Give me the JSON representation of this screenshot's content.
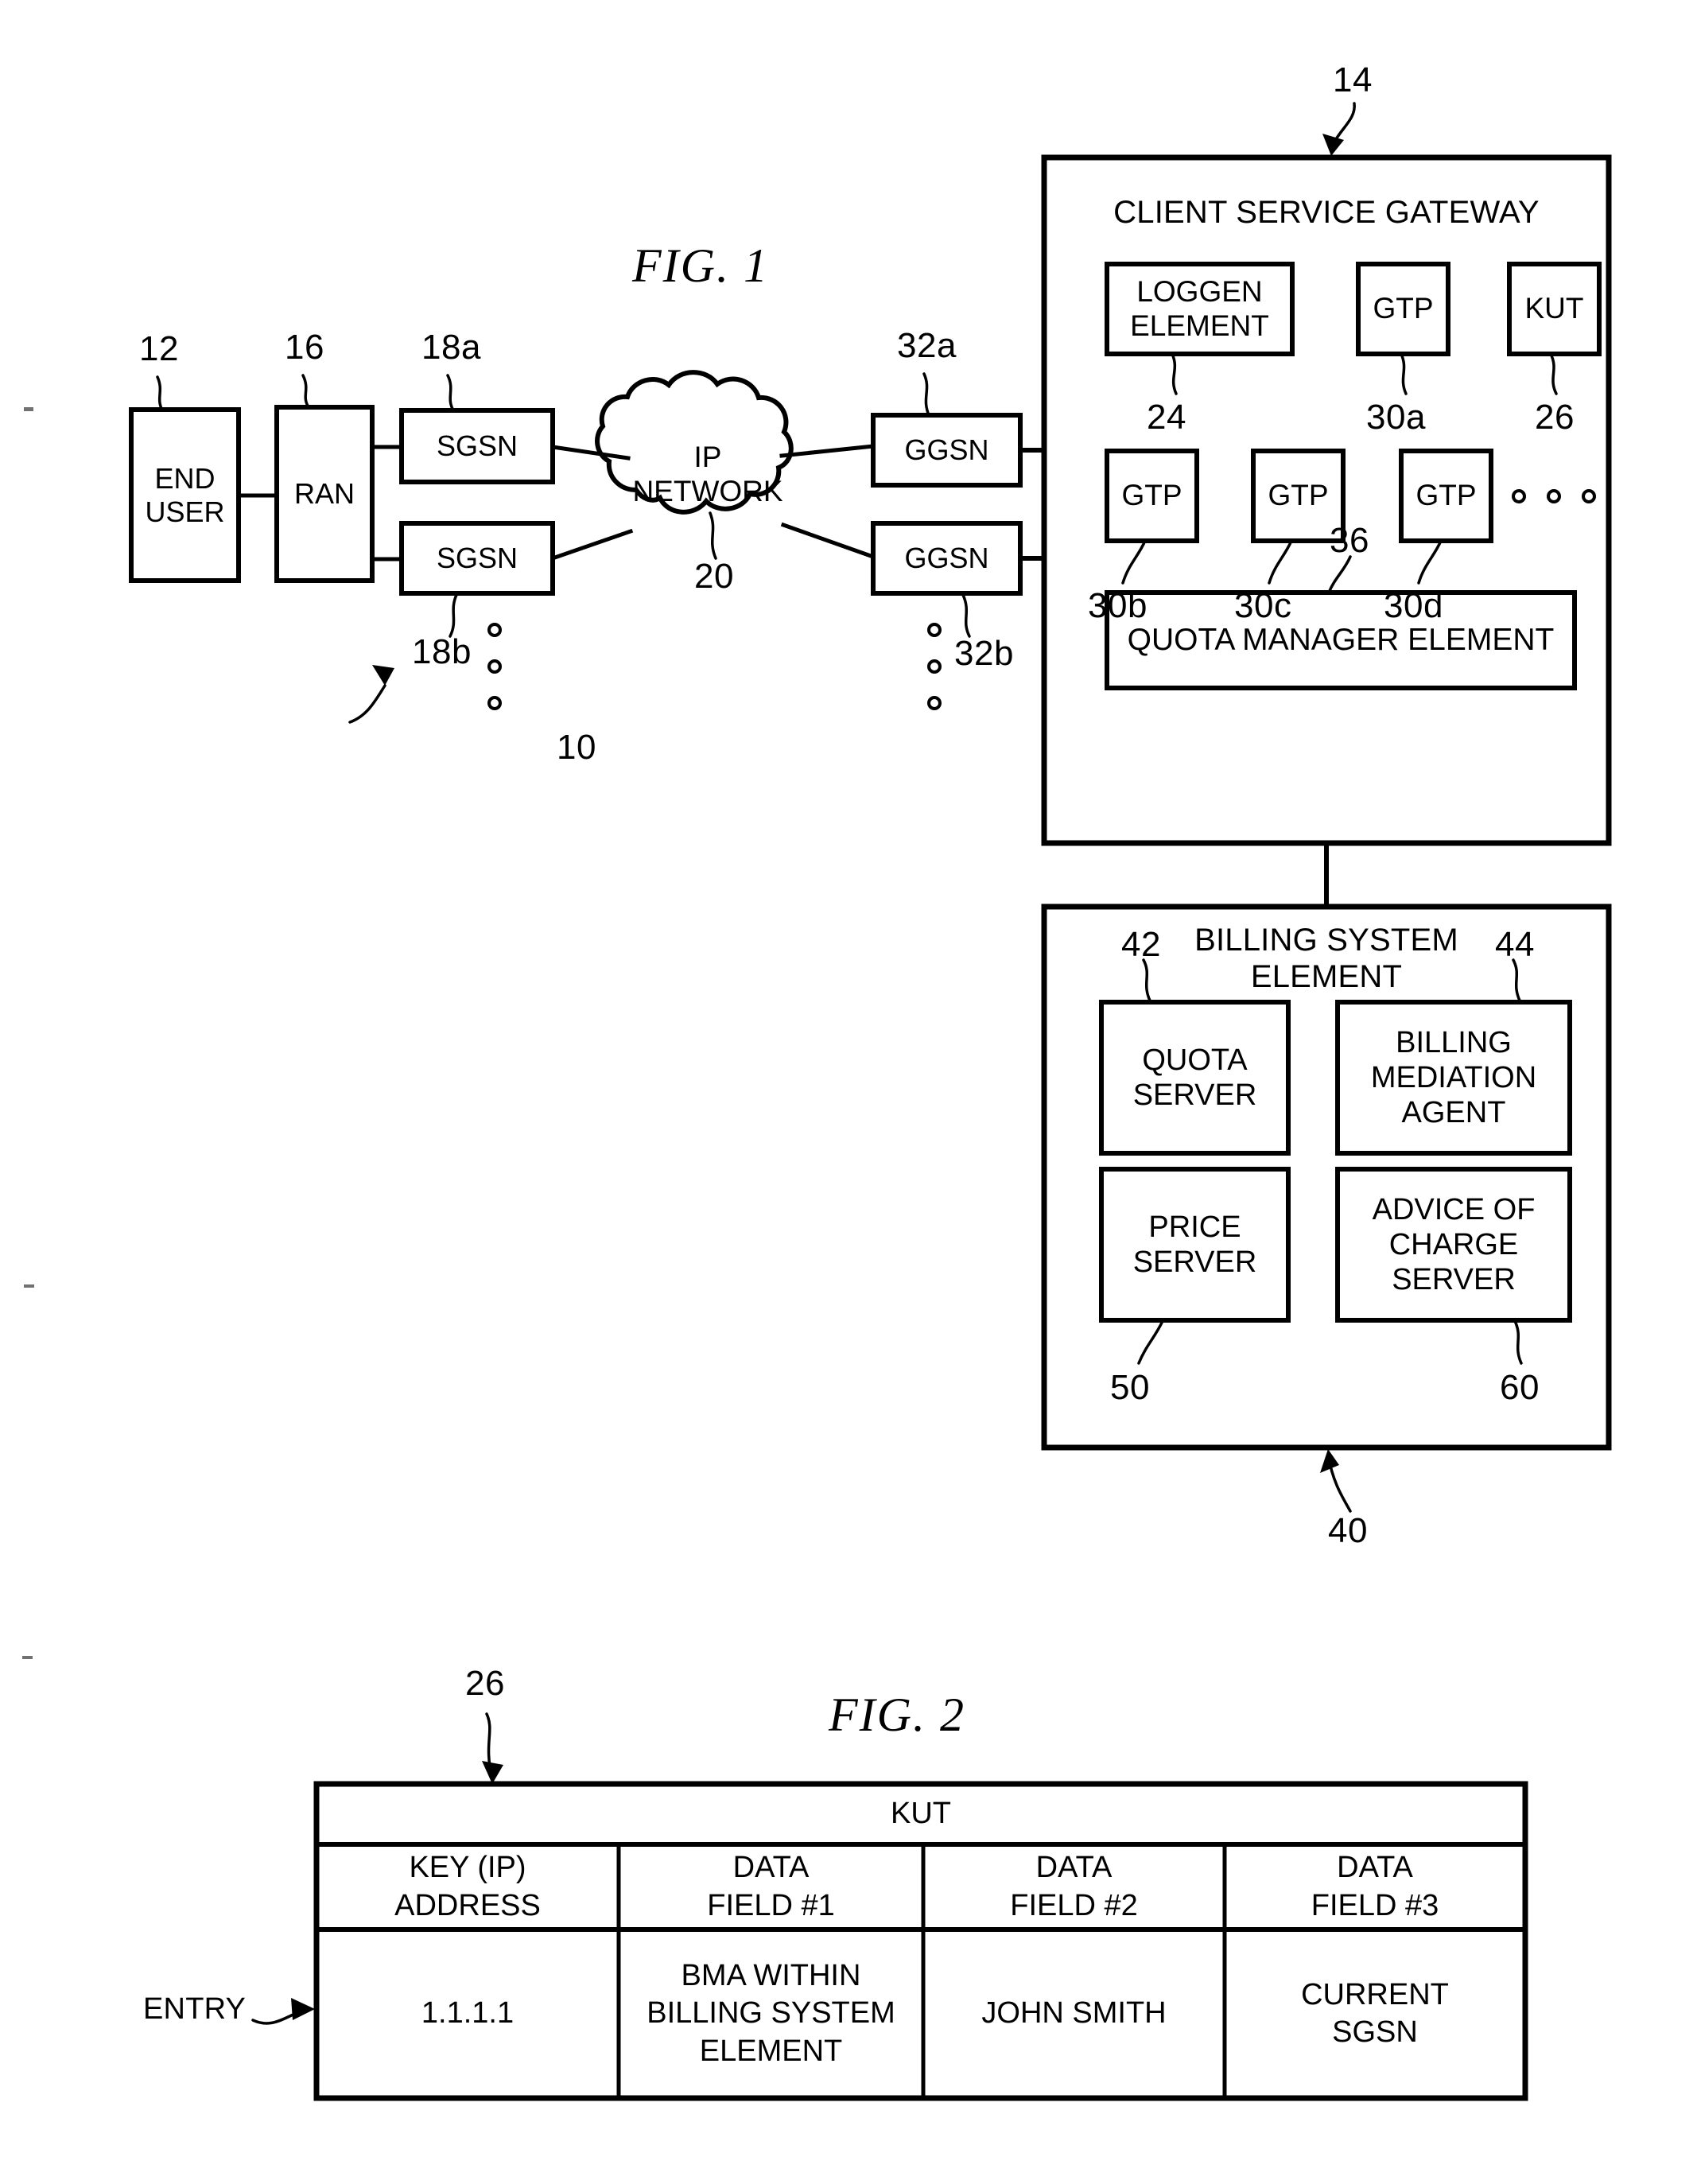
{
  "figures": [
    {
      "id": "fig1",
      "title": "FIG. 1"
    },
    {
      "id": "fig2",
      "title": "FIG. 2"
    }
  ],
  "fig1": {
    "title": "FIG. 1",
    "system_ref": "10",
    "nodes": {
      "end_user": {
        "label": "END\nUSER",
        "ref": "12"
      },
      "ran": {
        "label": "RAN",
        "ref": "16"
      },
      "sgsn_a": {
        "label": "SGSN",
        "ref": "18a"
      },
      "sgsn_b": {
        "label": "SGSN",
        "ref": "18b"
      },
      "ip_network": {
        "label": "IP\nNETWORK",
        "ref": "20"
      },
      "ggsn_a": {
        "label": "GGSN",
        "ref": "32a"
      },
      "ggsn_b": {
        "label": "GGSN",
        "ref": "32b"
      }
    },
    "client_service_gateway": {
      "title": "CLIENT SERVICE GATEWAY",
      "ref": "14",
      "children": [
        {
          "label": "LOGGEN\nELEMENT",
          "ref": "24"
        },
        {
          "label": "GTP",
          "ref": "30a"
        },
        {
          "label": "KUT",
          "ref": "26"
        },
        {
          "label": "GTP",
          "ref": "30b"
        },
        {
          "label": "GTP",
          "ref": "30c"
        },
        {
          "label": "GTP",
          "ref": "30d"
        },
        {
          "label": "QUOTA MANAGER ELEMENT",
          "ref": "36"
        }
      ]
    },
    "billing_system_element": {
      "title": "BILLING SYSTEM\nELEMENT",
      "ref": "40",
      "children": [
        {
          "label": "QUOTA\nSERVER",
          "ref": "42"
        },
        {
          "label": "BILLING\nMEDIATION\nAGENT",
          "ref": "44"
        },
        {
          "label": "PRICE\nSERVER",
          "ref": "50"
        },
        {
          "label": "ADVICE OF\nCHARGE\nSERVER",
          "ref": "60"
        }
      ]
    }
  },
  "fig2": {
    "title": "FIG. 2",
    "table_ref": "26",
    "entry_label": "ENTRY",
    "table": {
      "caption": "KUT",
      "headers": [
        "KEY (IP)\nADDRESS",
        "DATA\nFIELD #1",
        "DATA\nFIELD #2",
        "DATA\nFIELD #3"
      ],
      "rows": [
        [
          "1.1.1.1",
          "BMA WITHIN\nBILLING SYSTEM\nELEMENT",
          "JOHN SMITH",
          "CURRENT\nSGSN"
        ]
      ]
    }
  },
  "colors": {
    "ink": "#000000",
    "paper": "#ffffff"
  }
}
